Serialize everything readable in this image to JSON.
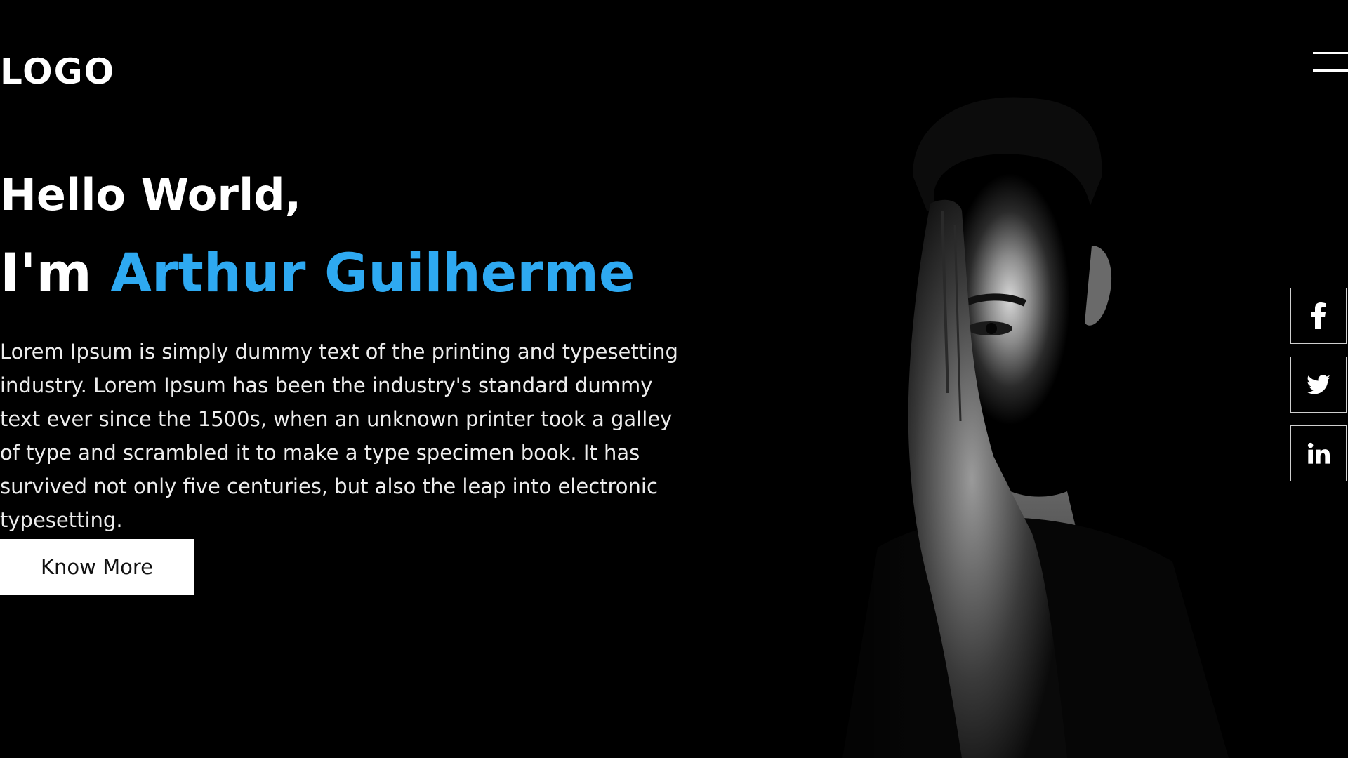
{
  "header": {
    "logo": "LOGO",
    "menu_icon": "hamburger-menu-icon"
  },
  "hero": {
    "greeting": "Hello World,",
    "intro_prefix": "I'm ",
    "name": "Arthur Guilherme",
    "description": "Lorem Ipsum is simply dummy text of the printing and typesetting industry. Lorem Ipsum has been the industry's standard dummy text ever since the 1500s, when an unknown printer took a galley of type and scrambled it to make a type specimen book. It has survived not only five centuries, but also the leap into electronic typesetting.",
    "cta_label": "Know More",
    "portrait": "black-and-white-portrait-of-man-covering-half-face-with-hand"
  },
  "social": [
    {
      "icon": "facebook-icon"
    },
    {
      "icon": "twitter-icon"
    },
    {
      "icon": "linkedin-icon"
    }
  ],
  "colors": {
    "background": "#000000",
    "accent": "#2ea9f1",
    "text": "#ffffff",
    "button_bg": "#ffffff",
    "button_text": "#111111"
  }
}
